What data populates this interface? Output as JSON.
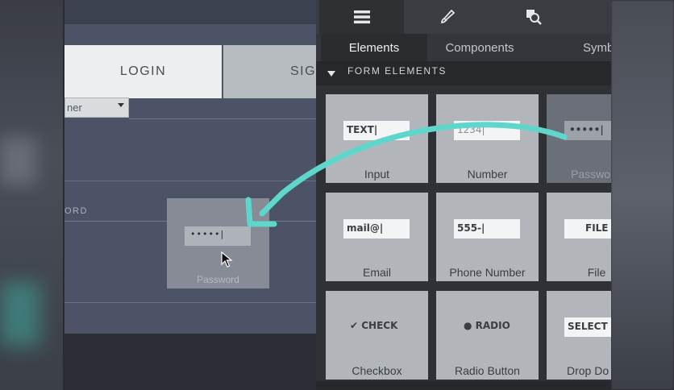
{
  "canvas": {
    "login_tab": "LOGIN",
    "signup_tab": "SIG",
    "select_value": "ner",
    "password_label_fragment": "ORD",
    "dropped_field_value": "•••••|",
    "dropped_field_label": "Password"
  },
  "panel": {
    "toolbar_icons": [
      "menu-icon",
      "brush-icon",
      "inspect-icon"
    ],
    "tabs": [
      "Elements",
      "Components",
      "Symb"
    ],
    "active_tab": "Elements",
    "section_title": "FORM ELEMENTS",
    "tiles": [
      {
        "label": "Input",
        "field": "TEXT|"
      },
      {
        "label": "Number",
        "field": "1234|"
      },
      {
        "label": "Passwo",
        "field": "•••••|"
      },
      {
        "label": "Email",
        "field": "mail@|"
      },
      {
        "label": "Phone Number",
        "field": "555-|"
      },
      {
        "label": "File",
        "field": "FILE"
      },
      {
        "label": "Checkbox",
        "field": "✔ CHECK"
      },
      {
        "label": "Radio Button",
        "field": "● RADIO"
      },
      {
        "label": "Drop Do",
        "field": "SELECT"
      }
    ]
  },
  "colors": {
    "arrow": "#5fd6cb",
    "panel_bg": "#2f3135",
    "tile_bg": "#b2b6bb",
    "canvas_bg": "#4c5366"
  }
}
